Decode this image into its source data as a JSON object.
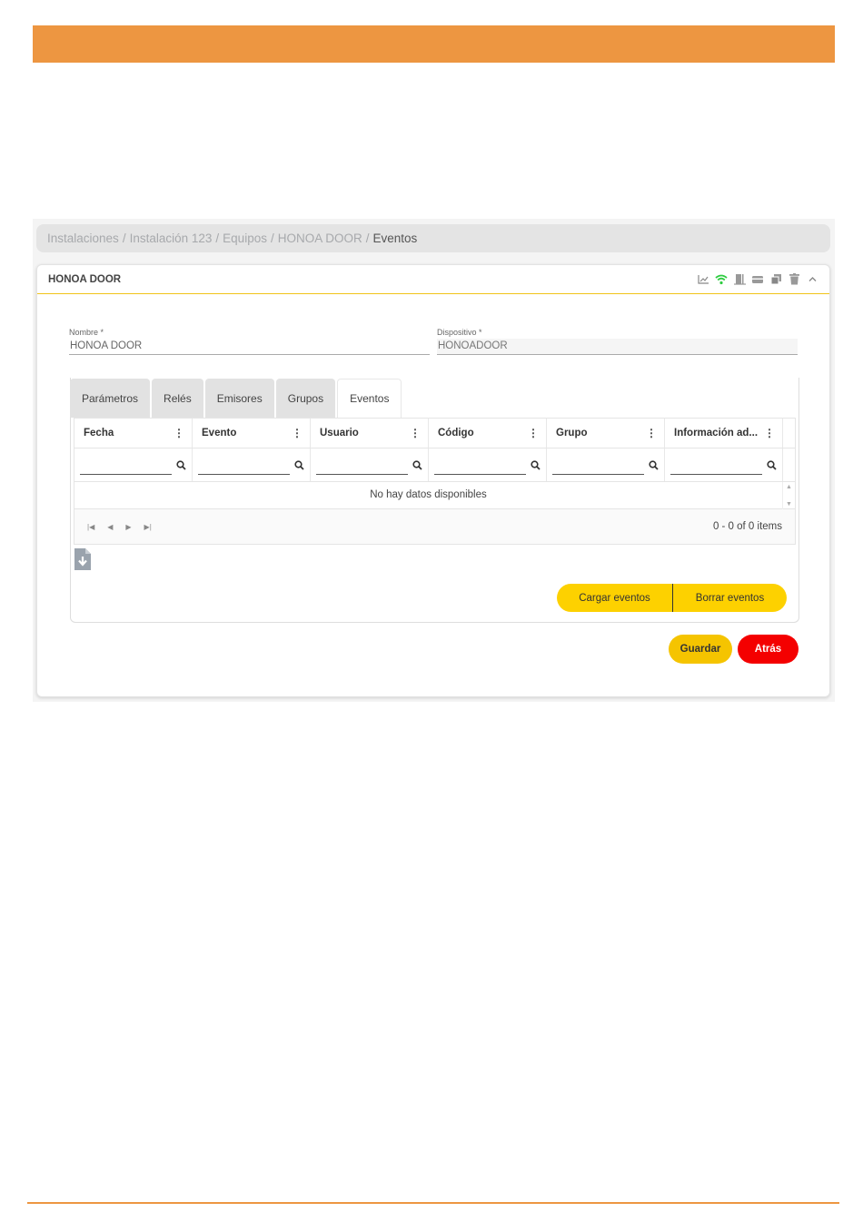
{
  "breadcrumb": {
    "items": [
      "Instalaciones",
      "Instalación 123",
      "Equipos",
      "HONOA DOOR"
    ],
    "separator": "/",
    "current": "Eventos"
  },
  "card": {
    "title": "HONOA DOOR",
    "actions": [
      "chart-icon",
      "wifi-icon",
      "door-icon",
      "card-reader-icon",
      "copy-icon",
      "trash-icon",
      "chevron-up-icon"
    ],
    "wifi_color": "#2ecc40"
  },
  "form": {
    "nombre": {
      "label": "Nombre *",
      "value": "HONOA DOOR"
    },
    "dispositivo": {
      "label": "Dispositivo *",
      "value": "HONOADOOR"
    }
  },
  "tabs": [
    {
      "label": "Parámetros",
      "active": false
    },
    {
      "label": "Relés",
      "active": false
    },
    {
      "label": "Emisores",
      "active": false
    },
    {
      "label": "Grupos",
      "active": false
    },
    {
      "label": "Eventos",
      "active": true
    }
  ],
  "grid": {
    "columns": [
      "Fecha",
      "Evento",
      "Usuario",
      "Código",
      "Grupo",
      "Información ad..."
    ],
    "menu_glyph": "⋮",
    "empty_message": "No hay datos disponibles",
    "pager_info": "0 - 0 of 0 items"
  },
  "buttons": {
    "cargar": "Cargar eventos",
    "borrar": "Borrar eventos",
    "guardar": "Guardar",
    "atras": "Atrás"
  },
  "colors": {
    "header_band": "#ed9641",
    "accent_yellow": "#fdd100",
    "danger_red": "#f40000"
  }
}
